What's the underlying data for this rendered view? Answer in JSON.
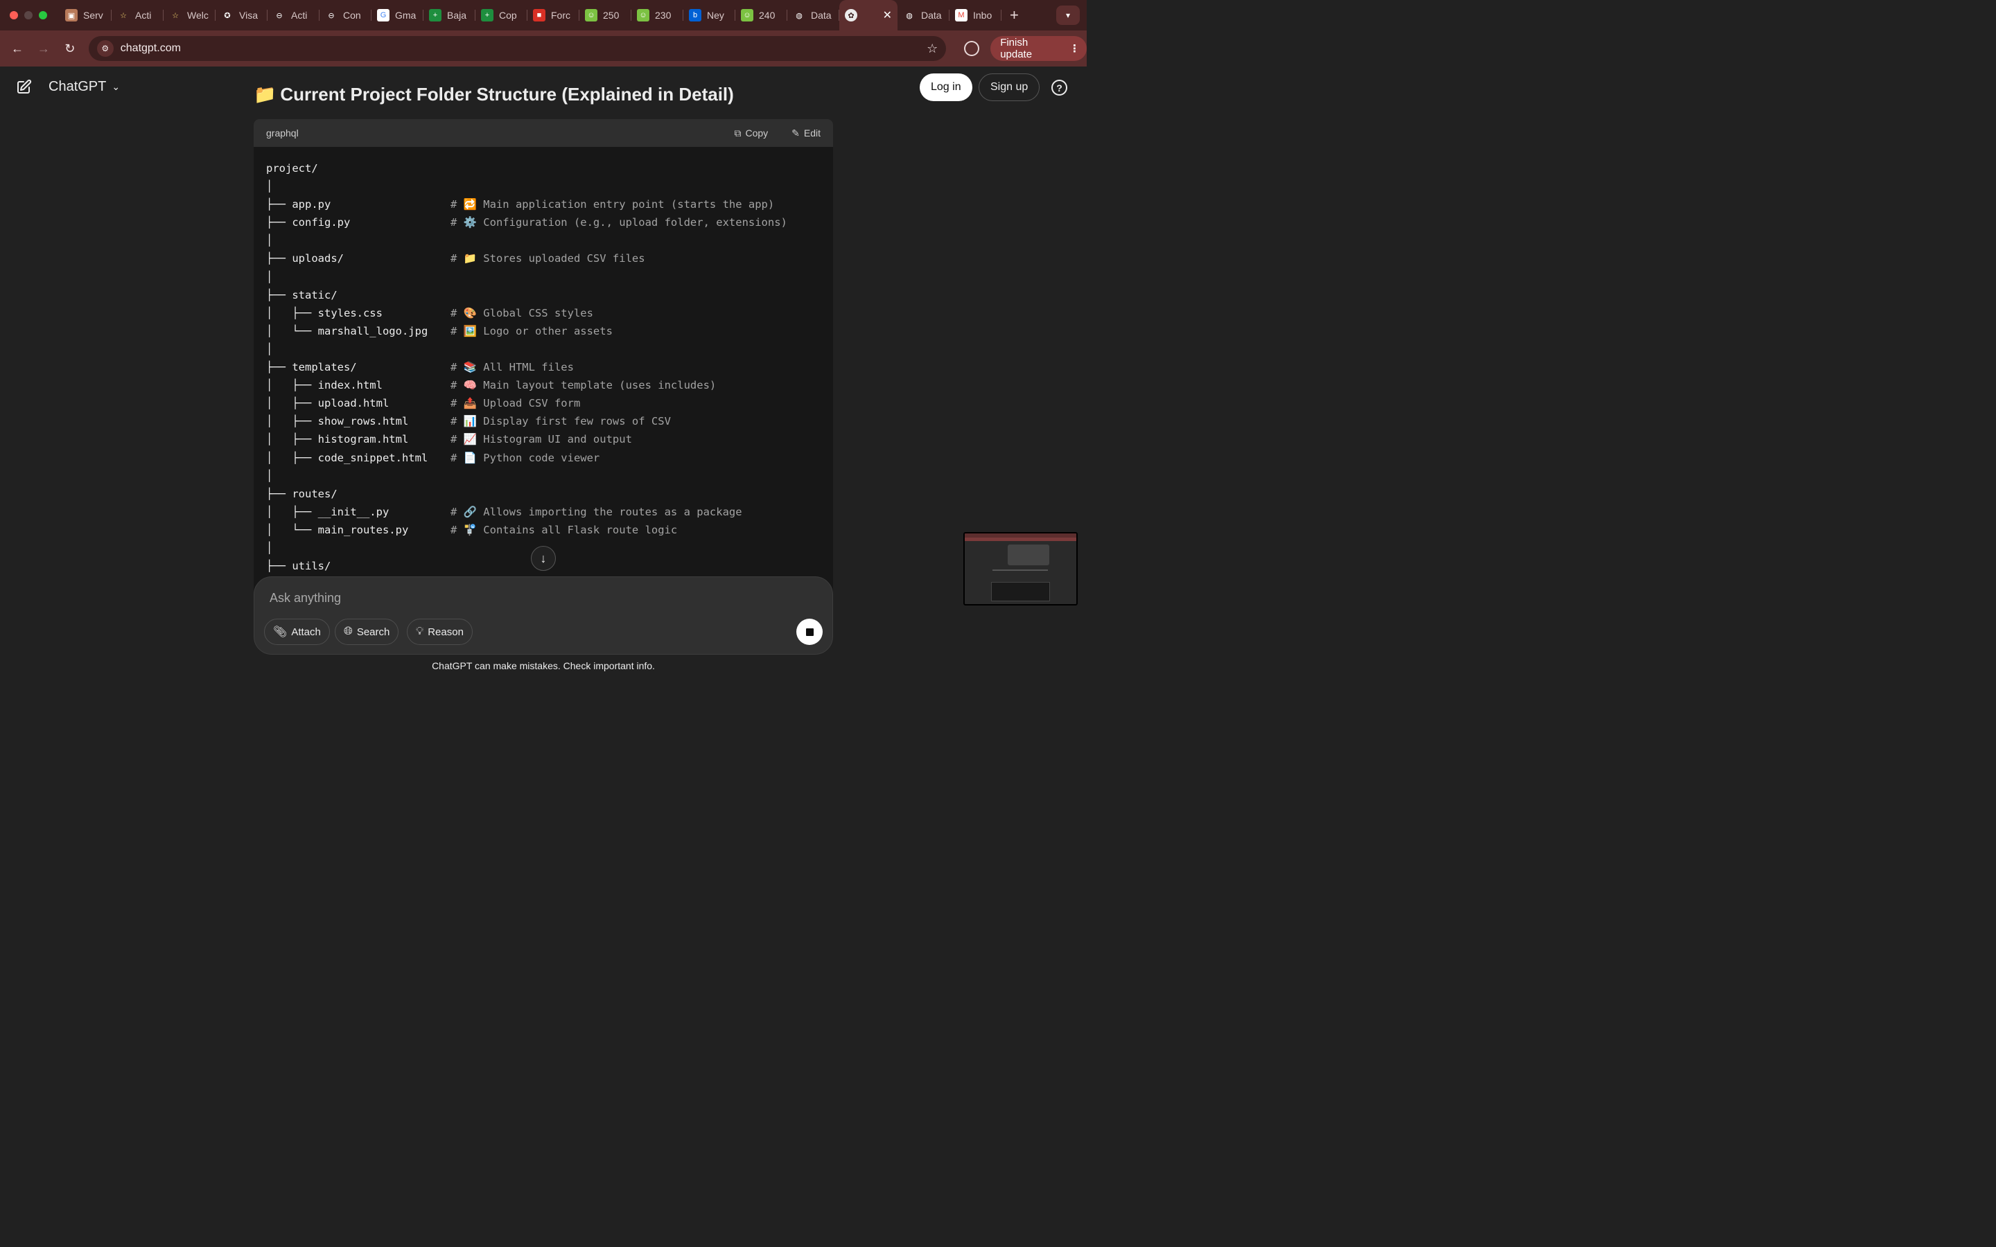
{
  "browser": {
    "tabs": [
      {
        "label": "Serv",
        "favicon": "portrait-icon",
        "fav_color": "#b87a5a"
      },
      {
        "label": "Acti",
        "favicon": "star-icon",
        "fav_color": "#3c1f1f"
      },
      {
        "label": "Welc",
        "favicon": "star-icon",
        "fav_color": "#3c1f1f"
      },
      {
        "label": "Visa",
        "favicon": "seal-icon",
        "fav_color": "#3c1f1f"
      },
      {
        "label": "Acti",
        "favicon": "link-icon",
        "fav_color": "#3c1f1f"
      },
      {
        "label": "Con",
        "favicon": "link-icon",
        "fav_color": "#3c1f1f"
      },
      {
        "label": "Gma",
        "favicon": "google-icon",
        "fav_color": "#ffffff"
      },
      {
        "label": "Baja",
        "favicon": "plus-sheet-icon",
        "fav_color": "#1e8e3e"
      },
      {
        "label": "Cop",
        "favicon": "plus-sheet-icon",
        "fav_color": "#1e8e3e"
      },
      {
        "label": "Forc",
        "favicon": "brand-badge-icon",
        "fav_color": "#d93025"
      },
      {
        "label": "250",
        "favicon": "smiley-icon",
        "fav_color": "#7cc242"
      },
      {
        "label": "230",
        "favicon": "smiley-icon",
        "fav_color": "#7cc242"
      },
      {
        "label": "Ney",
        "favicon": "box-icon",
        "fav_color": "#0061d5"
      },
      {
        "label": "240",
        "favicon": "smiley-icon",
        "fav_color": "#7cc242"
      },
      {
        "label": "Data",
        "favicon": "globe-icon",
        "fav_color": "#3c1f1f"
      }
    ],
    "active_tab": {
      "label": "",
      "favicon": "openai-icon",
      "close": "✕"
    },
    "tabs_after": [
      {
        "label": "Data",
        "favicon": "globe-icon",
        "fav_color": "#3c1f1f"
      },
      {
        "label": "Inbo",
        "favicon": "gmail-icon",
        "fav_color": "#ffffff"
      }
    ],
    "new_tab": "+",
    "url": "chatgpt.com",
    "finish_update": "Finish update",
    "colors": {
      "frame": "#3c1f1f",
      "toolbar": "#5c2e2e",
      "accent": "#8a3a3a"
    }
  },
  "header": {
    "model": "ChatGPT",
    "login": "Log in",
    "signup": "Sign up",
    "help": "?"
  },
  "heading": {
    "emoji": "📁",
    "text": "Current Project Folder Structure (Explained in Detail)"
  },
  "code_block": {
    "language": "graphql",
    "copy_label": "Copy",
    "edit_label": "Edit",
    "lines": [
      {
        "tree": "project/",
        "comment": ""
      },
      {
        "tree": "│",
        "comment": ""
      },
      {
        "tree": "├── app.py",
        "comment": "# 🔁 Main application entry point (starts the app)"
      },
      {
        "tree": "├── config.py",
        "comment": "# ⚙️ Configuration (e.g., upload folder, extensions)"
      },
      {
        "tree": "│",
        "comment": ""
      },
      {
        "tree": "├── uploads/",
        "comment": "# 📁 Stores uploaded CSV files"
      },
      {
        "tree": "│",
        "comment": ""
      },
      {
        "tree": "├── static/",
        "comment": ""
      },
      {
        "tree": "│   ├── styles.css",
        "comment": "# 🎨 Global CSS styles"
      },
      {
        "tree": "│   └── marshall_logo.jpg",
        "comment": "# 🖼️ Logo or other assets"
      },
      {
        "tree": "│",
        "comment": ""
      },
      {
        "tree": "├── templates/",
        "comment": "# 📚 All HTML files"
      },
      {
        "tree": "│   ├── index.html",
        "comment": "# 🧠 Main layout template (uses includes)"
      },
      {
        "tree": "│   ├── upload.html",
        "comment": "# 📤 Upload CSV form"
      },
      {
        "tree": "│   ├── show_rows.html",
        "comment": "# 📊 Display first few rows of CSV"
      },
      {
        "tree": "│   ├── histogram.html",
        "comment": "# 📈 Histogram UI and output"
      },
      {
        "tree": "│   ├── code_snippet.html",
        "comment": "# 📄 Python code viewer"
      },
      {
        "tree": "│",
        "comment": ""
      },
      {
        "tree": "├── routes/",
        "comment": ""
      },
      {
        "tree": "│   ├── __init__.py",
        "comment": "# 🔗 Allows importing the routes as a package"
      },
      {
        "tree": "│   └── main_routes.py",
        "comment": "# 🚏 Contains all Flask route logic"
      },
      {
        "tree": "│",
        "comment": ""
      },
      {
        "tree": "├── utils/",
        "comment": ""
      }
    ]
  },
  "composer": {
    "placeholder": "Ask anything",
    "attach": "Attach",
    "search": "Search",
    "reason": "Reason"
  },
  "disclaimer": "ChatGPT can make mistakes. Check important info."
}
